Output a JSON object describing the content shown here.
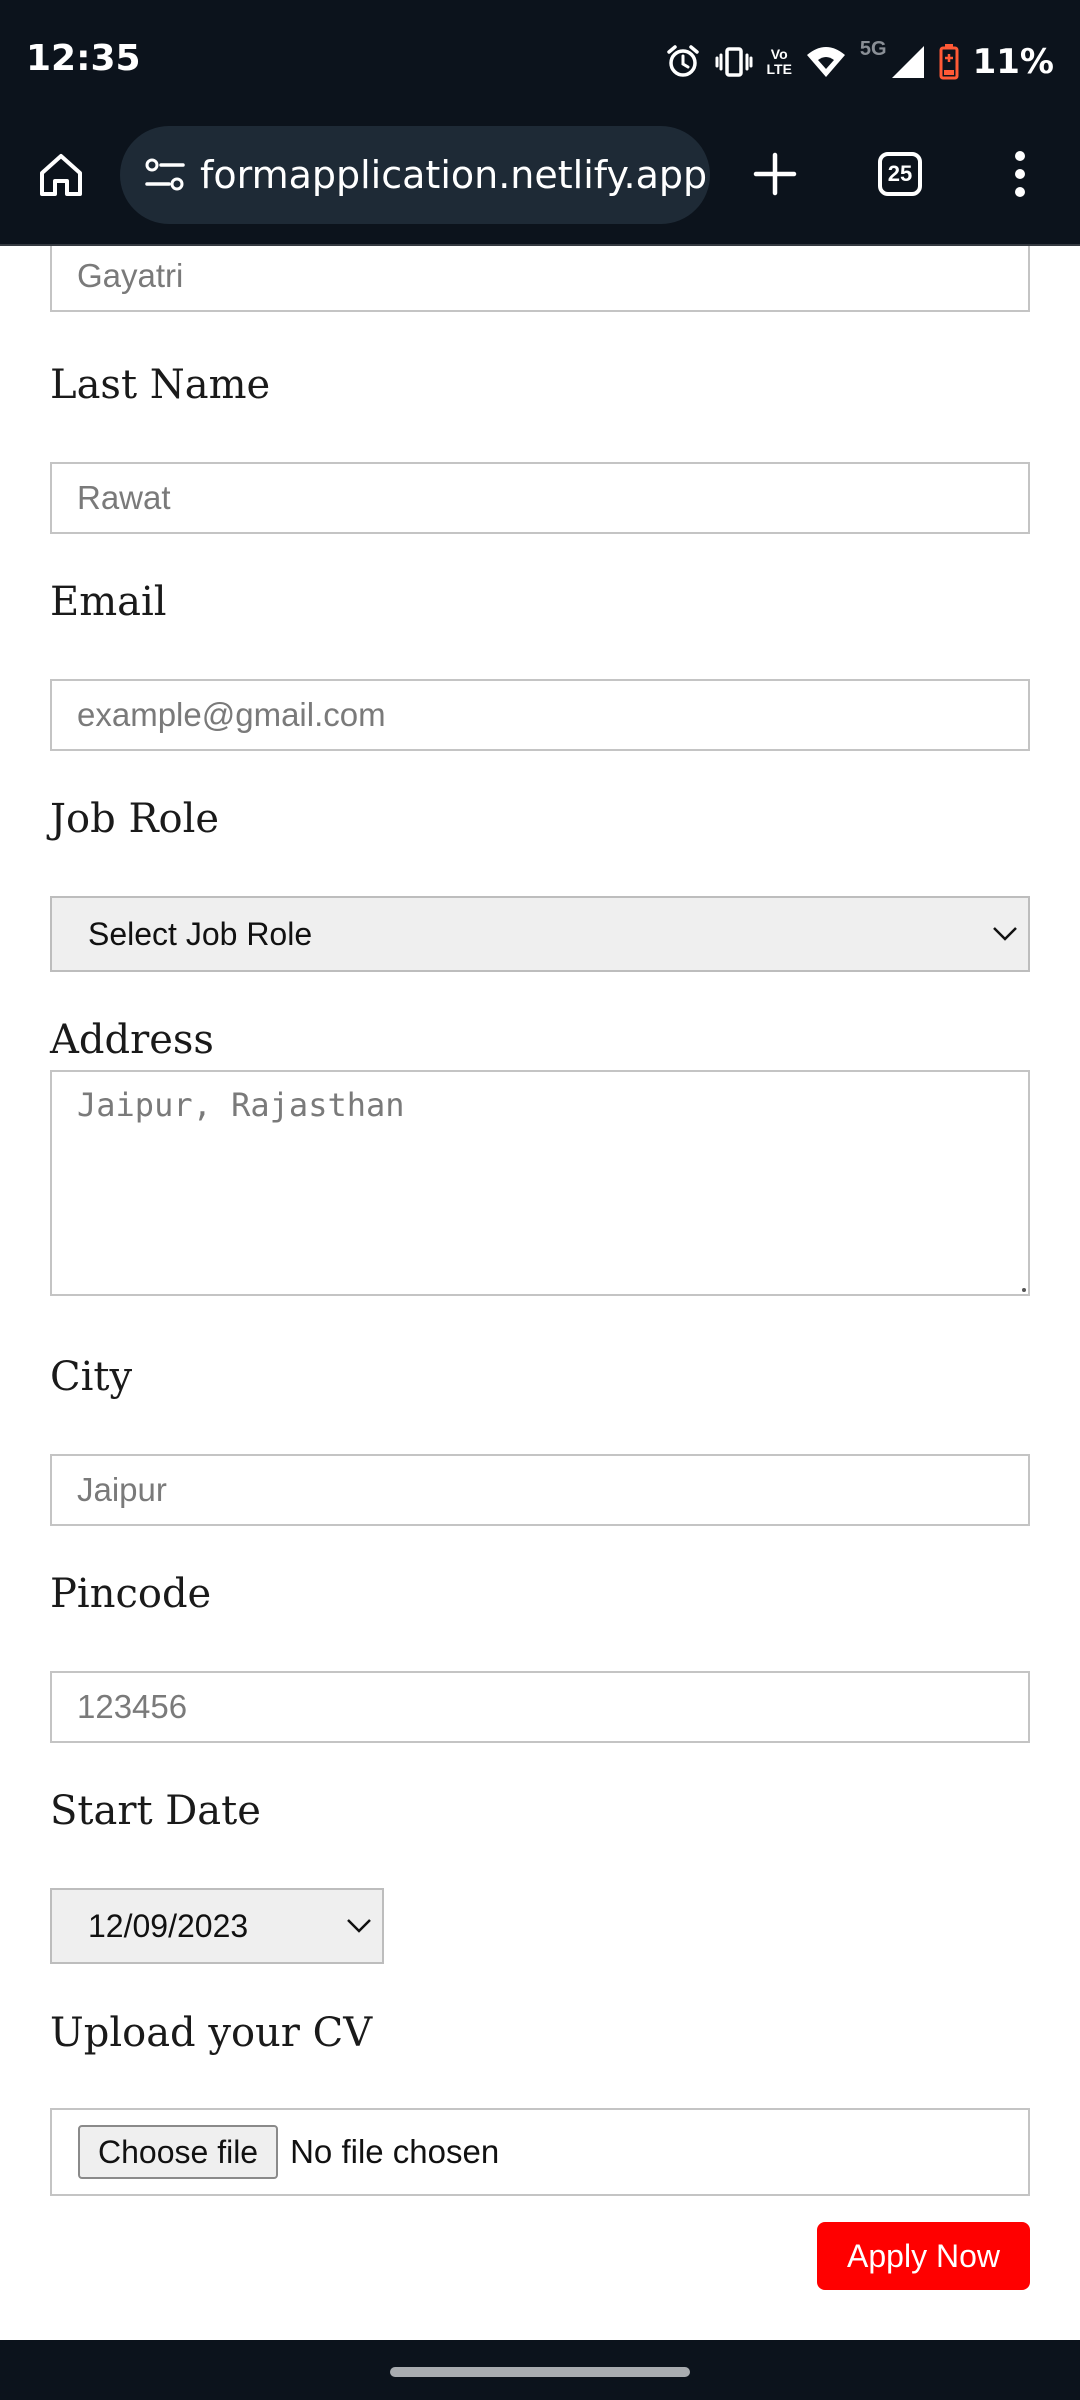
{
  "status_bar": {
    "time": "12:35",
    "network_label": "5G",
    "lte_label_top": "Vo",
    "lte_label_bottom": "LTE",
    "battery_percent": "11%",
    "battery_color": "#ff5a36",
    "icons": [
      "alarm-icon",
      "vibrate-icon",
      "volte-icon",
      "wifi-icon",
      "signal-icon",
      "battery-icon"
    ]
  },
  "browser": {
    "url": "formapplication.netlify.app",
    "tab_count": "25",
    "icons": [
      "home-icon",
      "site-settings-icon",
      "plus-icon",
      "tabs-icon",
      "more-vert-icon"
    ]
  },
  "form": {
    "first_name": {
      "value": "",
      "placeholder": "Gayatri"
    },
    "last_name": {
      "label": "Last Name",
      "value": "",
      "placeholder": "Rawat"
    },
    "email": {
      "label": "Email",
      "value": "",
      "placeholder": "example@gmail.com"
    },
    "job_role": {
      "label": "Job Role",
      "selected": "Select Job Role"
    },
    "address": {
      "label": "Address",
      "value": "",
      "placeholder": "Jaipur, Rajasthan"
    },
    "city": {
      "label": "City",
      "value": "",
      "placeholder": "Jaipur"
    },
    "pincode": {
      "label": "Pincode",
      "value": "",
      "placeholder": "123456"
    },
    "start_date": {
      "label": "Start Date",
      "value": "12/09/2023"
    },
    "cv": {
      "label": "Upload your CV",
      "button_label": "Choose file",
      "status": "No file chosen"
    },
    "submit_label": "Apply Now",
    "submit_color": "#ff0000"
  }
}
